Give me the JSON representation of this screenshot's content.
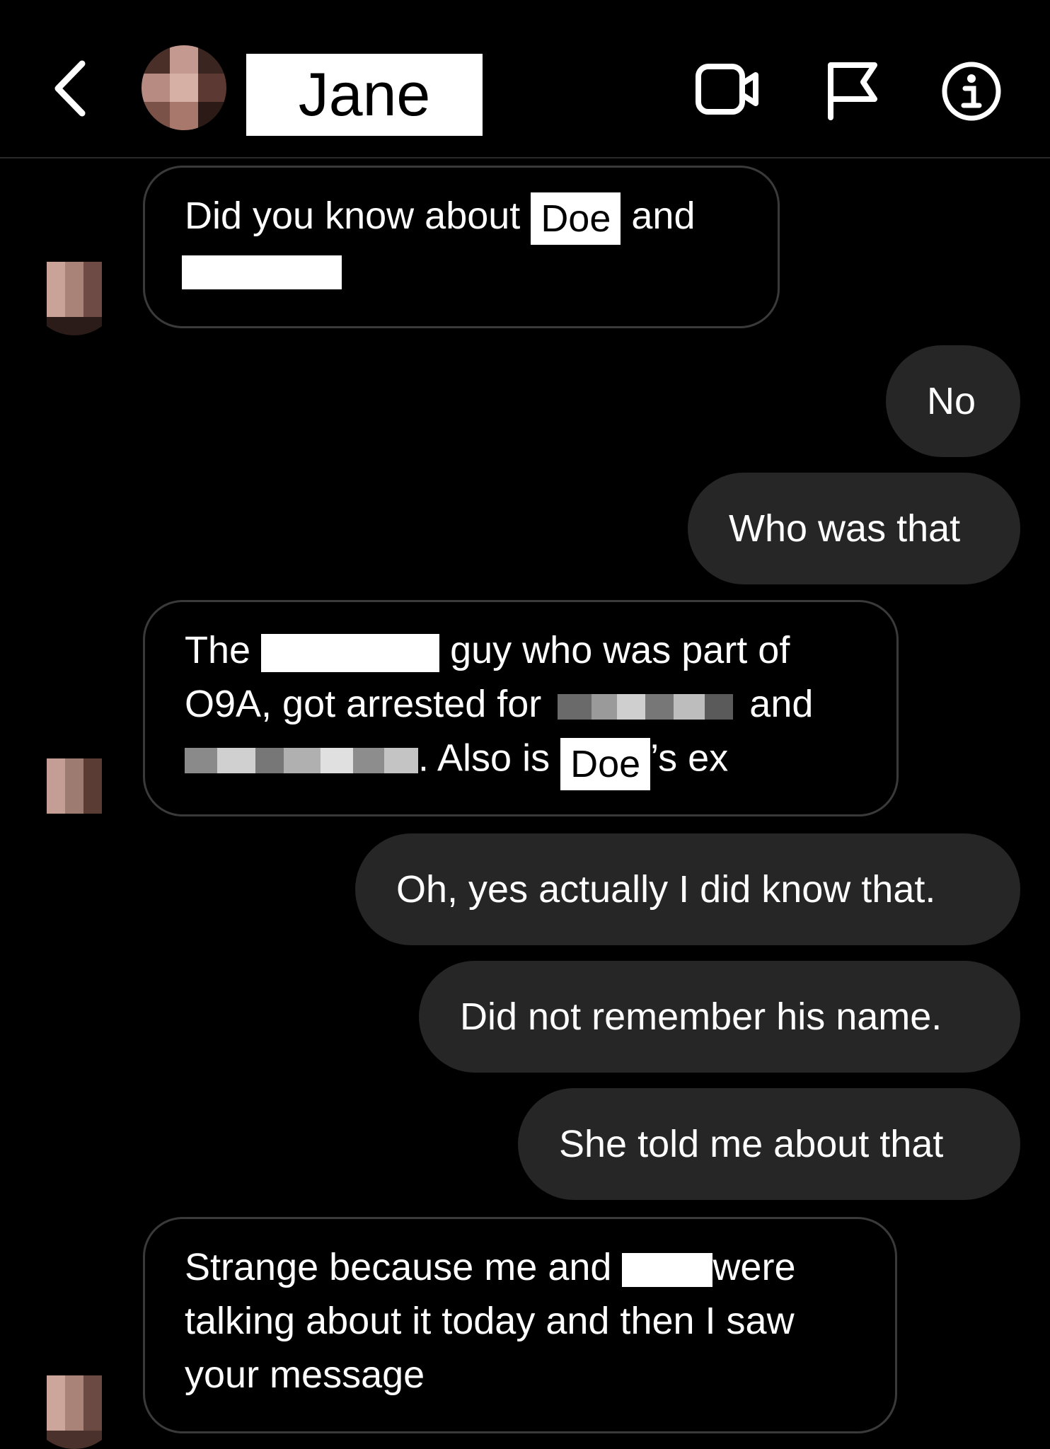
{
  "header": {
    "contact_name": "Jane",
    "icons": [
      "back-chevron-icon",
      "video-camera-icon",
      "flag-icon",
      "info-icon"
    ]
  },
  "messages": [
    {
      "from": "contact",
      "lines": [
        "Did you know about",
        "Doe",
        "and"
      ]
    },
    {
      "from": "me",
      "text": "No"
    },
    {
      "from": "me",
      "text": "Who was that"
    },
    {
      "from": "contact",
      "line1_a": "The",
      "line1_b": "guy who was part of",
      "line2_a": "O9A, got arrested for",
      "line2_b": "and",
      "line3_a": ". Also is",
      "line3_tag": "Doe",
      "line3_b": "’s ex"
    },
    {
      "from": "me",
      "text": "Oh, yes actually I did know that."
    },
    {
      "from": "me",
      "text": "Did not remember his name."
    },
    {
      "from": "me",
      "text": "She told me about that"
    },
    {
      "from": "contact",
      "line1_a": "Strange because me and",
      "line1_b": "were",
      "line2": "talking about it today and then I saw",
      "line3": "your message"
    }
  ],
  "colors": {
    "background": "#000000",
    "sent_bubble": "#262626",
    "received_border": "#3a3a3a",
    "text": "#ffffff"
  }
}
